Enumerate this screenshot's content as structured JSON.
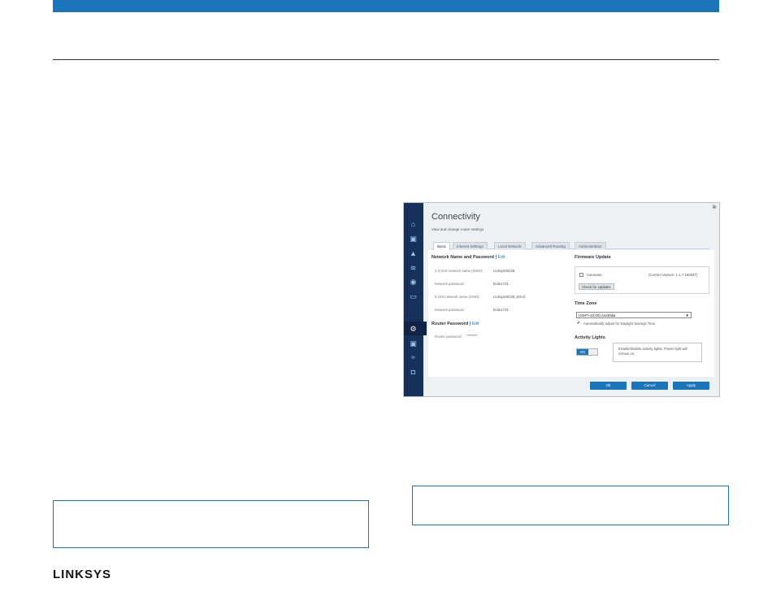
{
  "brand": {
    "logo": "LINKSYS",
    "accent": "#1b75bb",
    "sidebar_color": "#16325a"
  },
  "router_ui": {
    "title": "Connectivity",
    "subtitle": "View and change router settings",
    "close_glyph": "⊗",
    "tabs": [
      {
        "label": "Basic",
        "active": true
      },
      {
        "label": "Internet Settings",
        "active": false
      },
      {
        "label": "Local Network",
        "active": false
      },
      {
        "label": "Advanced Routing",
        "active": false
      },
      {
        "label": "Administration",
        "active": false
      }
    ],
    "network": {
      "title": "Network Name and Password",
      "edit": "Edit",
      "separator": "|",
      "rows": [
        {
          "label": "2.4 GHz network name (SSID):",
          "value": "Linksys00135"
        },
        {
          "label": "Network password:",
          "value": "bcde1731"
        },
        {
          "label": "5 GHz network name (SSID):",
          "value": "Linksys00135_5GHz"
        },
        {
          "label": "Network password:",
          "value": "bcde1731"
        }
      ]
    },
    "router_password": {
      "title": "Router Password",
      "edit": "Edit",
      "separator": "|",
      "label": "Router password:",
      "value": "********"
    },
    "firmware": {
      "title": "Firmware Update",
      "automatic_label": "Automatic",
      "automatic_checked": false,
      "current_version": "(Current Version: 1.1.7.160037)",
      "check_button": "Check for Updates"
    },
    "timezone": {
      "title": "Time Zone",
      "selected": "(GMT+10:00) Australia",
      "dst_label": "Automatically adjust for Daylight Savings Time",
      "dst_checked": true
    },
    "activity_lights": {
      "title": "Activity Lights",
      "toggle_state": "ON",
      "tooltip": "Enable/disable activity lights. Power light will remain on."
    },
    "footer": {
      "ok": "Ok",
      "cancel": "Cancel",
      "apply": "Apply"
    },
    "sidebar_icons": [
      "router-icon",
      "devices-icon",
      "troubleshooting-icon",
      "wireless-icon",
      "security-icon",
      "speed-icon",
      "connectivity-icon",
      "media-icon",
      "guest-icon",
      "parental-icon"
    ]
  }
}
